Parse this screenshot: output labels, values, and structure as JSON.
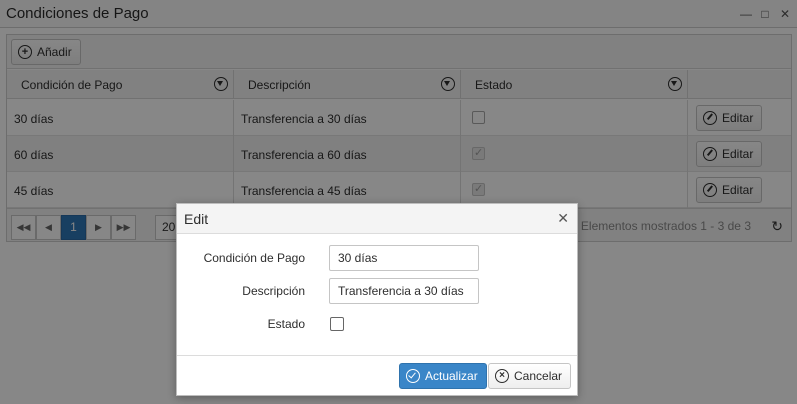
{
  "window": {
    "title": "Condiciones de Pago",
    "controls": [
      "minimize",
      "maximize",
      "close"
    ]
  },
  "toolbar": {
    "add_label": "Añadir"
  },
  "columns": [
    {
      "label": "Condición de Pago"
    },
    {
      "label": "Descripción"
    },
    {
      "label": "Estado"
    },
    {
      "label": ""
    }
  ],
  "rows": [
    {
      "condicion": "30 días",
      "descripcion": "Transferencia a 30 días",
      "estado": false,
      "action": "Editar"
    },
    {
      "condicion": "60 días",
      "descripcion": "Transferencia a 60 días",
      "estado": true,
      "action": "Editar"
    },
    {
      "condicion": "45 días",
      "descripcion": "Transferencia a 45 días",
      "estado": true,
      "action": "Editar"
    }
  ],
  "pager": {
    "current_page": "1",
    "page_size": "20",
    "info": "Elementos mostrados 1 - 3 de 3"
  },
  "dialog": {
    "title": "Edit",
    "fields": {
      "condicion_label": "Condición de Pago",
      "condicion_value": "30 días",
      "descripcion_label": "Descripción",
      "descripcion_value": "Transferencia a 30 días",
      "estado_label": "Estado",
      "estado_checked": false
    },
    "update_label": "Actualizar",
    "cancel_label": "Cancelar"
  },
  "colors": {
    "accent": "#3a86c8",
    "pager_active": "#2f78b8",
    "overlay": "#000000"
  }
}
